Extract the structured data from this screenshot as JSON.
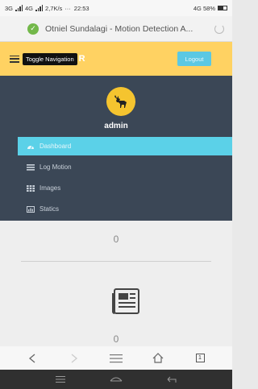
{
  "status_bar": {
    "left": "3G",
    "network2": "4G",
    "speed": "2,7K/s",
    "dots": "···",
    "time": "22:53",
    "battery": "4G 58%"
  },
  "browser": {
    "tab_title": "Otniel Sundalagi - Motion Detection A...",
    "tab_count": "1"
  },
  "navbar": {
    "tooltip": "Toggle Navigation",
    "brand_fragment": "R",
    "logout_label": "Logout"
  },
  "sidebar": {
    "username": "admin",
    "items": [
      {
        "label": "Dashboard",
        "icon": "dashboard-icon"
      },
      {
        "label": "Log Motion",
        "icon": "list-icon"
      },
      {
        "label": "Images",
        "icon": "grid-icon"
      },
      {
        "label": "Statics",
        "icon": "chart-icon"
      }
    ]
  },
  "content": {
    "top_count": "0",
    "bottom_count": "0"
  },
  "colors": {
    "navbar": "#ffd262",
    "sidebar": "#3b4756",
    "accent": "#5bd1e8",
    "avatar": "#f5c42f"
  }
}
